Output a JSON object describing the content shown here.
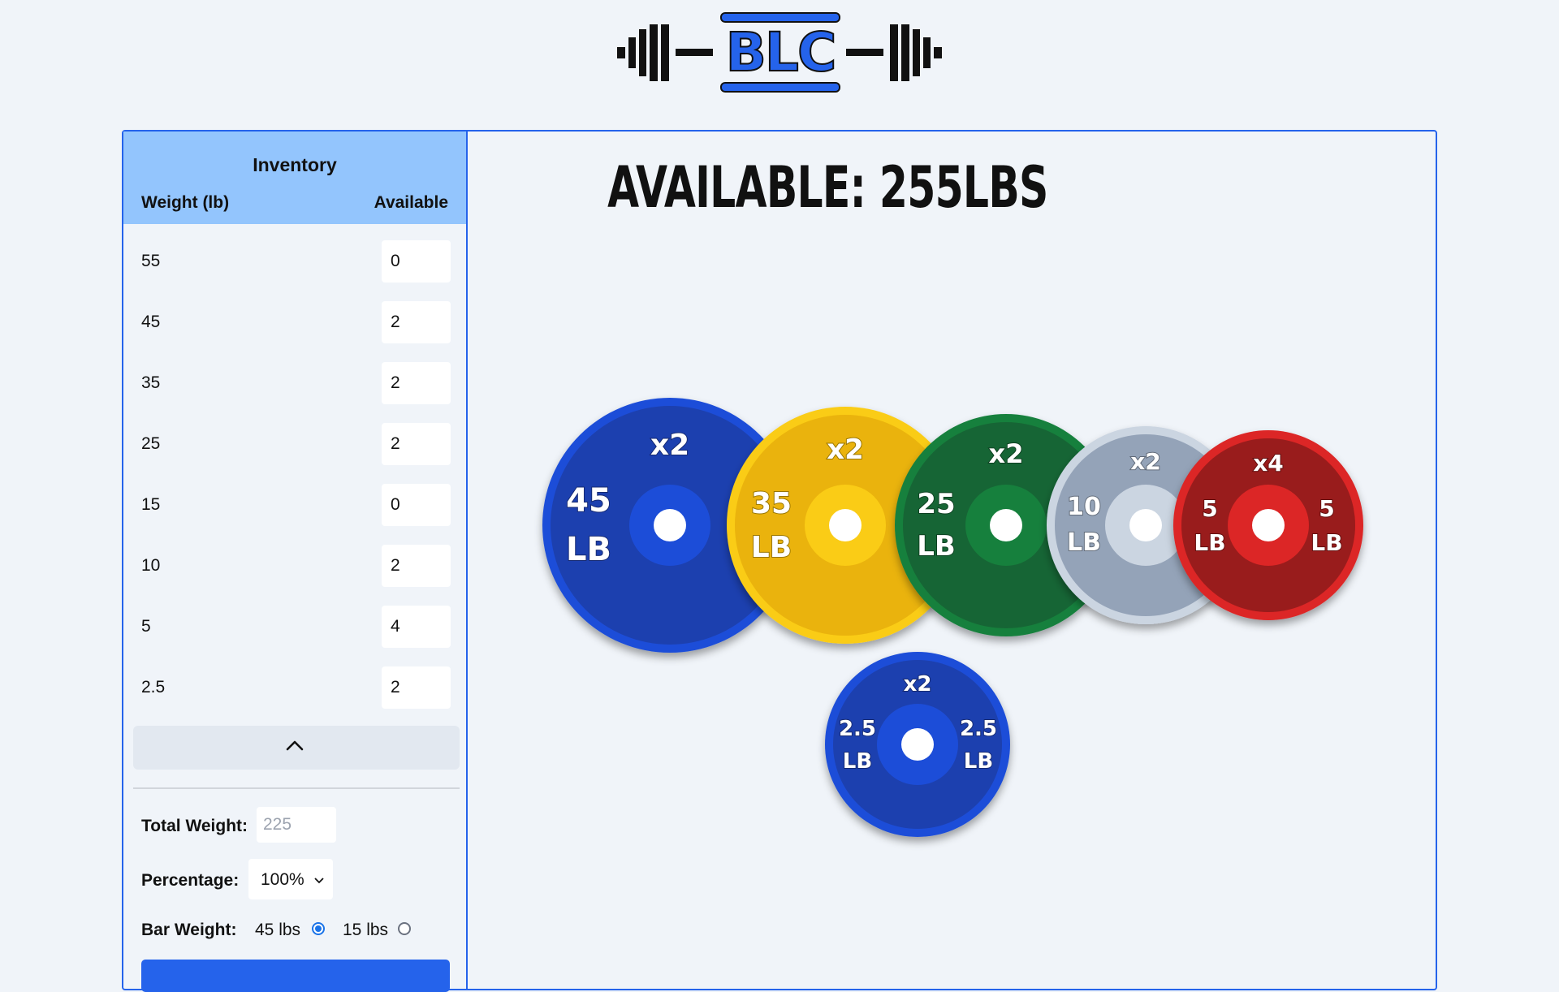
{
  "logo": {
    "text": "BLC"
  },
  "inventory": {
    "title": "Inventory",
    "col_weight": "Weight (lb)",
    "col_available": "Available",
    "rows": [
      {
        "weight": "55",
        "available": "0"
      },
      {
        "weight": "45",
        "available": "2"
      },
      {
        "weight": "35",
        "available": "2"
      },
      {
        "weight": "25",
        "available": "2"
      },
      {
        "weight": "15",
        "available": "0"
      },
      {
        "weight": "10",
        "available": "2"
      },
      {
        "weight": "5",
        "available": "4"
      },
      {
        "weight": "2.5",
        "available": "2"
      }
    ]
  },
  "controls": {
    "total_weight_label": "Total Weight:",
    "total_weight_placeholder": "225",
    "percentage_label": "Percentage:",
    "percentage_value": "100%",
    "bar_weight_label": "Bar Weight:",
    "bar_options": [
      {
        "label": "45 lbs",
        "selected": true
      },
      {
        "label": "15 lbs",
        "selected": false
      }
    ]
  },
  "display": {
    "available_text": "AVAILABLE: 255LBS",
    "plates": [
      {
        "weight": "45",
        "unit": "LB",
        "count": "x2",
        "color": "#1e40af"
      },
      {
        "weight": "35",
        "unit": "LB",
        "count": "x2",
        "color": "#eab308"
      },
      {
        "weight": "25",
        "unit": "LB",
        "count": "x2",
        "color": "#166534"
      },
      {
        "weight": "10",
        "unit": "LB",
        "count": "x2",
        "color": "#94a3b8"
      },
      {
        "weight": "5",
        "unit": "LB",
        "count": "x4",
        "color": "#b91c1c"
      },
      {
        "weight": "2.5",
        "unit": "LB",
        "count": "x2",
        "color": "#1e40af"
      }
    ]
  },
  "colors": {
    "accent": "#2563eb",
    "header_bg": "#93c5fd",
    "page_bg": "#f0f4f9"
  }
}
